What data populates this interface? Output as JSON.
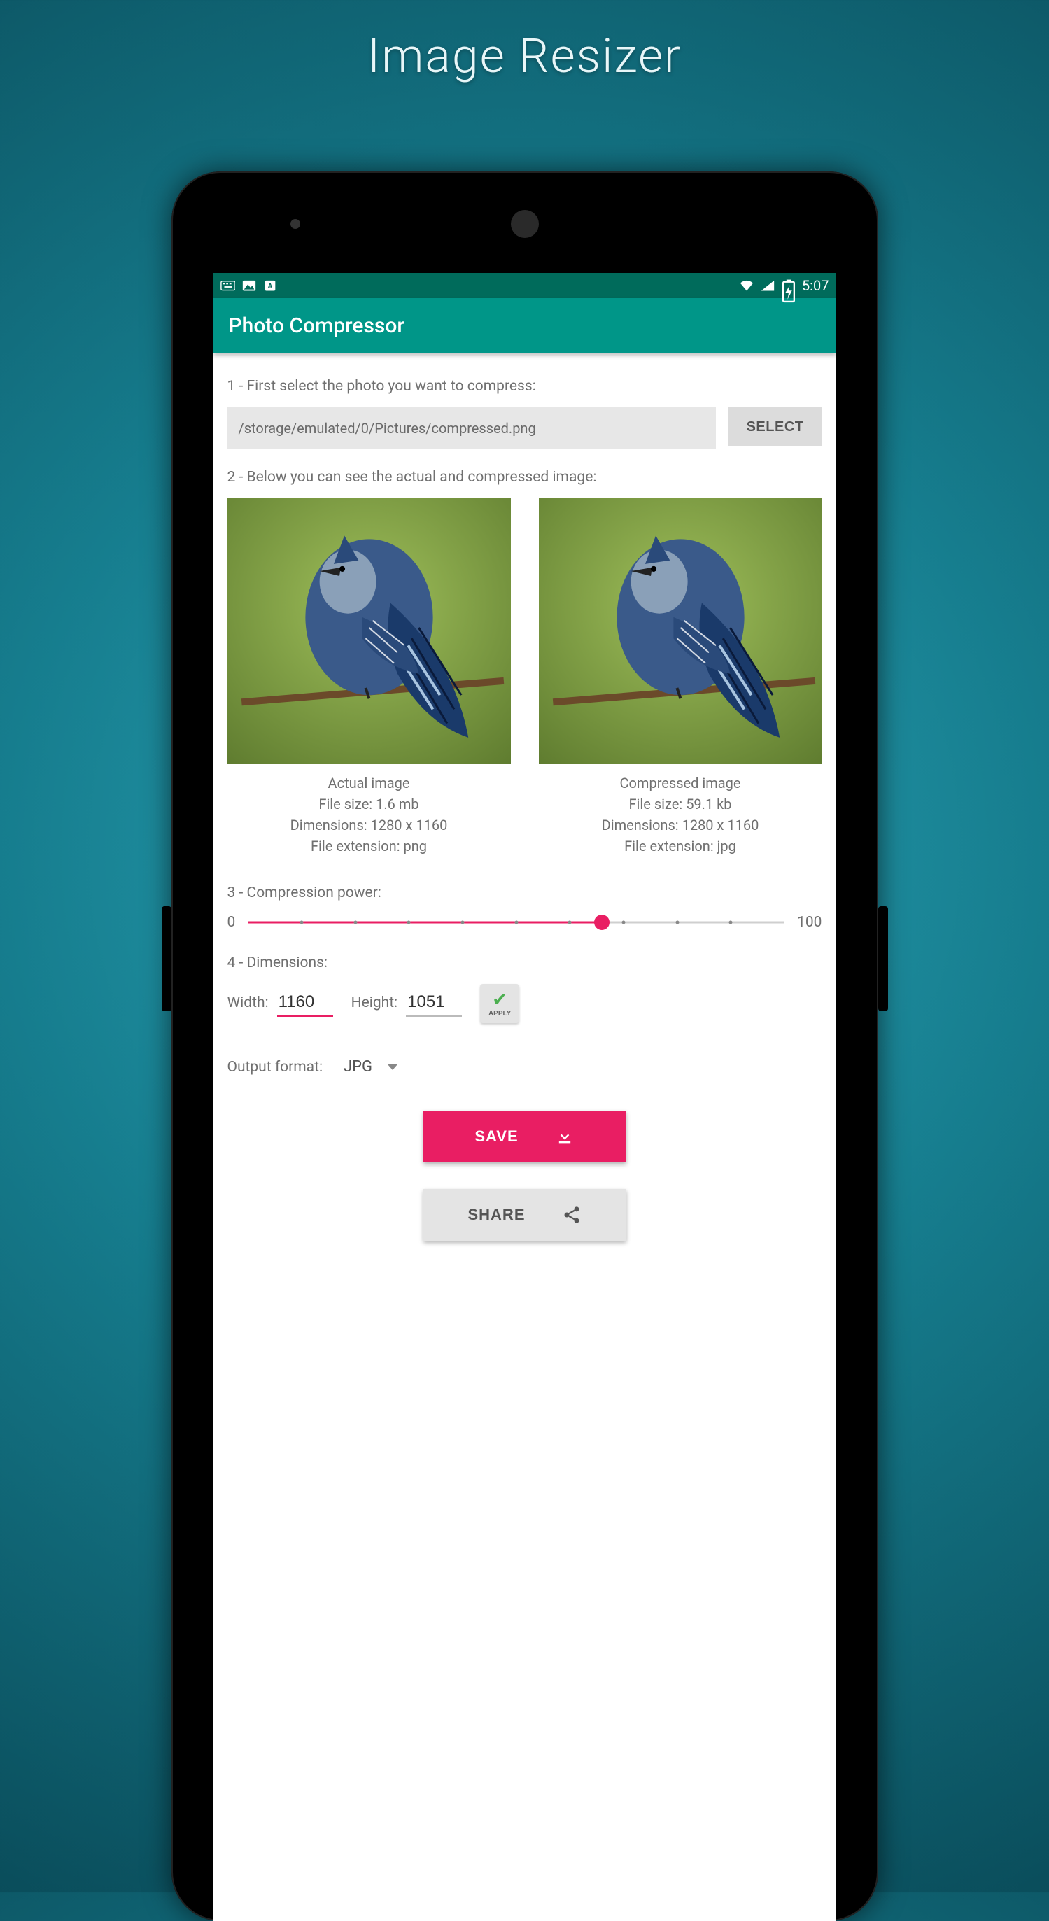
{
  "page_title": "Image Resizer",
  "statusbar": {
    "time": "5:07"
  },
  "appbar": {
    "title": "Photo Compressor"
  },
  "steps": {
    "s1_label": "1 - First select the photo you want to compress:",
    "path_value": "/storage/emulated/0/Pictures/compressed.png",
    "select_label": "SELECT",
    "s2_label": "2 - Below you can see the actual and compressed image:",
    "s3_label": "3 - Compression power:",
    "s4_label": "4 - Dimensions:"
  },
  "previews": {
    "actual": {
      "title": "Actual image",
      "file_size": "File size: 1.6 mb",
      "dimensions": "Dimensions: 1280 x 1160",
      "extension": "File extension:  png"
    },
    "compressed": {
      "title": "Compressed image",
      "file_size": "File size: 59.1 kb",
      "dimensions": "Dimensions: 1280 x 1160",
      "extension": "File extension:  jpg"
    }
  },
  "slider": {
    "min_label": "0",
    "max_label": "100",
    "percent": 66
  },
  "dimensions": {
    "width_label": "Width:",
    "width_value": "1160",
    "height_label": "Height:",
    "height_value": "1051",
    "apply_label": "APPLY"
  },
  "format": {
    "label": "Output format:",
    "selected": "JPG"
  },
  "buttons": {
    "save": "SAVE",
    "share": "SHARE"
  },
  "colors": {
    "accent": "#e91e63",
    "appbar": "#009688"
  }
}
